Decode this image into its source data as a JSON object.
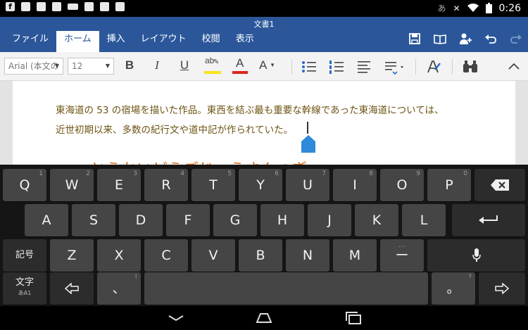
{
  "status_bar": {
    "left_icons": [
      "facebook-icon",
      "message-icon",
      "message-icon",
      "message-icon",
      "keyboard-icon",
      "clipboard-icon",
      "shopping-bag-icon",
      "bag-check-icon"
    ],
    "ime_indicator": "あ",
    "time": "0:26"
  },
  "title_bar": {
    "document_title": "文書1",
    "tabs": [
      "ファイル",
      "ホーム",
      "挿入",
      "レイアウト",
      "校閲",
      "表示"
    ],
    "active_tab": "ホーム",
    "icons": [
      "save-icon",
      "read-mode-icon",
      "share-icon",
      "undo-icon",
      "redo-icon"
    ]
  },
  "toolbar": {
    "font_name": "Arial (本文の",
    "font_size": "12",
    "bold": "B",
    "italic": "I",
    "underline": "U",
    "highlight": "ab",
    "font_color": "A",
    "font_size_change": "A",
    "highlight_color": "#f7e51b",
    "font_color_bar": "#d9261c"
  },
  "document": {
    "line1": "東海道の 53 の宿場を描いた作品。東西を結ぶ最も重要な幹線であった東海道については、",
    "line2": "近世初期以来、多数の紀行文や道中記が作られていた。",
    "composing_text": "とうかいどうごじゅうさんつぎ",
    "text_color": "#6d5412",
    "composing_color": "#d96a14"
  },
  "keyboard": {
    "row1": [
      {
        "label": "Q",
        "hint": "1"
      },
      {
        "label": "W",
        "hint": "2"
      },
      {
        "label": "E",
        "hint": "3"
      },
      {
        "label": "R",
        "hint": "4"
      },
      {
        "label": "T",
        "hint": "5"
      },
      {
        "label": "Y",
        "hint": "6"
      },
      {
        "label": "U",
        "hint": "7"
      },
      {
        "label": "I",
        "hint": "8"
      },
      {
        "label": "O",
        "hint": "9"
      },
      {
        "label": "P",
        "hint": "0"
      }
    ],
    "row2": [
      "A",
      "S",
      "D",
      "F",
      "G",
      "H",
      "J",
      "K",
      "L"
    ],
    "row3": [
      "Z",
      "X",
      "C",
      "V",
      "B",
      "N",
      "M",
      "ー"
    ],
    "row3_hint_dash": "…",
    "symbols_key": "記号",
    "mode_key_label": "文字",
    "mode_key_sub": "あA1",
    "comma_key": "、",
    "comma_hint": "!",
    "period_key": "。",
    "period_hint": "?"
  }
}
